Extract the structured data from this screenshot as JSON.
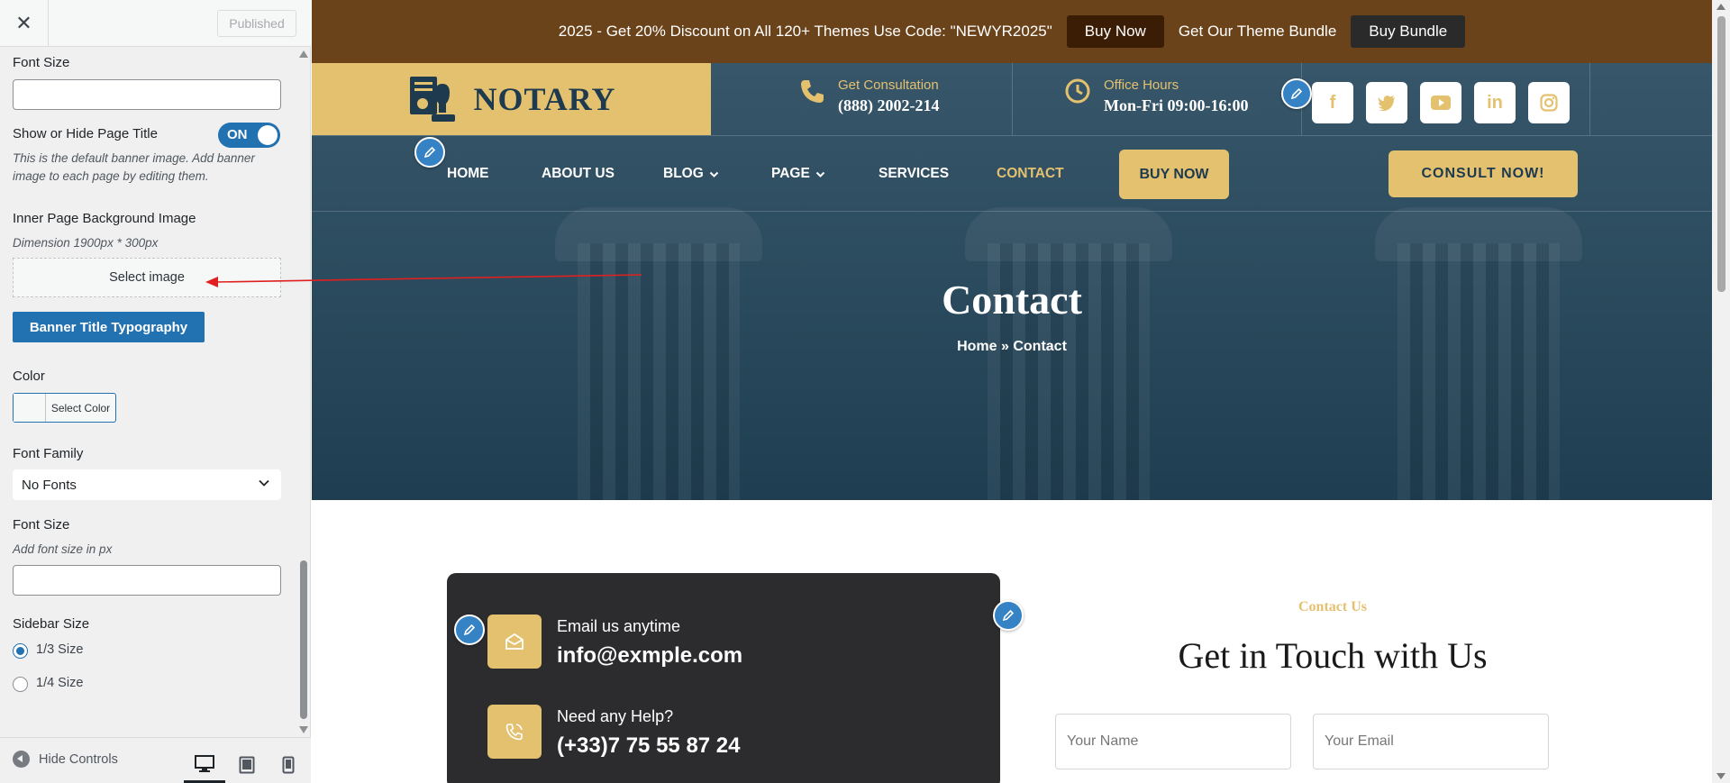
{
  "customizer": {
    "close_label": "✕",
    "published_label": "Published",
    "fields": {
      "font_size_top_label": "Font Size",
      "show_hide_title_label": "Show or Hide Page Title",
      "toggle_label": "ON",
      "default_banner_desc": "This is the default banner image. Add banner image to each page by editing them.",
      "inner_bg_label": "Inner Page Background Image",
      "dimension_desc": "Dimension 1900px * 300px",
      "select_image_label": "Select image",
      "banner_typo_label": "Banner Title Typography",
      "color_label": "Color",
      "select_color_label": "Select Color",
      "font_family_label": "Font Family",
      "font_family_value": "No Fonts",
      "font_size_label": "Font Size",
      "font_size_desc": "Add font size in px",
      "sidebar_size_label": "Sidebar Size",
      "sidebar_options": [
        "1/3 Size",
        "1/4 Size"
      ]
    },
    "footer": {
      "hide_controls_label": "Hide Controls"
    }
  },
  "preview": {
    "topbar": {
      "promo_text": "2025 - Get 20% Discount on All 120+ Themes Use Code: \"NEWYR2025\"",
      "buy_now_label": "Buy Now",
      "bundle_text": "Get Our Theme Bundle",
      "buy_bundle_label": "Buy Bundle"
    },
    "header": {
      "logo_text": "NOTARY",
      "consultation_label": "Get Consultation",
      "consultation_phone": "(888) 2002-214",
      "hours_label": "Office Hours",
      "hours_value": "Mon-Fri 09:00-16:00",
      "social_icons": [
        "facebook-icon",
        "twitter-icon",
        "youtube-icon",
        "linkedin-icon",
        "instagram-icon"
      ]
    },
    "nav": {
      "items": [
        "HOME",
        "ABOUT US",
        "BLOG",
        "PAGE",
        "SERVICES",
        "CONTACT"
      ],
      "buy_now_label": "BUY NOW",
      "consult_label": "CONSULT NOW!"
    },
    "hero": {
      "title": "Contact",
      "breadcrumb": "Home  »  Contact"
    },
    "contact_info": {
      "email_label": "Email us anytime",
      "email_value": "info@exmple.com",
      "help_label": "Need any Help?",
      "help_value": "(+33)7 75 55 87 24"
    },
    "form": {
      "eyebrow": "Contact Us",
      "heading": "Get in Touch with Us",
      "name_placeholder": "Your Name",
      "email_placeholder": "Your Email"
    }
  },
  "colors": {
    "wp_blue": "#2271b1",
    "gold": "#e3c16f",
    "topbar_brown": "#6b431b",
    "navy": "#1e3a4f",
    "card_dark": "#2c2c2e",
    "annotation_red": "#e02020"
  }
}
